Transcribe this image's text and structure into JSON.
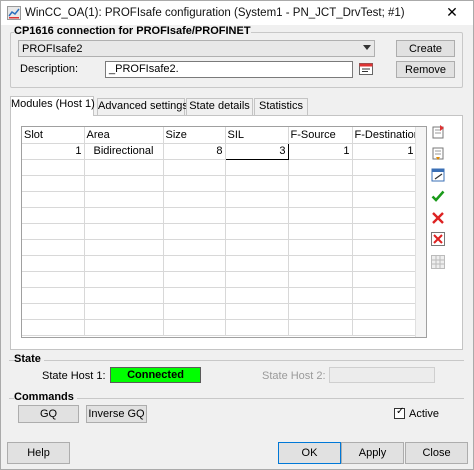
{
  "window": {
    "title": "WinCC_OA(1): PROFIsafe configuration (System1 - PN_JCT_DrvTest; #1)",
    "close_glyph": "✕"
  },
  "connection_group": {
    "title": "CP1616 connection for PROFIsafe/PROFINET",
    "selected_value": "PROFIsafe2",
    "create_label": "Create",
    "remove_label": "Remove",
    "description_label": "Description:",
    "description_value": "_PROFIsafe2."
  },
  "tabs": [
    {
      "label": "Modules (Host 1)",
      "active": true
    },
    {
      "label": "Advanced settings",
      "active": false
    },
    {
      "label": "State details",
      "active": false
    },
    {
      "label": "Statistics",
      "active": false
    }
  ],
  "modules_table": {
    "columns": [
      "Slot",
      "Area",
      "Size",
      "SIL",
      "F-Source",
      "F-Destination"
    ],
    "rows": [
      [
        "1",
        "Bidirectional",
        "8",
        "3",
        "1",
        "1"
      ]
    ]
  },
  "side_toolbar": [
    {
      "icon": "insert-row-icon"
    },
    {
      "icon": "append-row-icon"
    },
    {
      "icon": "edit-icon"
    },
    {
      "icon": "checkmark-icon"
    },
    {
      "icon": "delete-icon"
    },
    {
      "icon": "delete-all-icon"
    },
    {
      "icon": "grid-disabled-icon"
    }
  ],
  "state_group": {
    "title": "State",
    "host1_label": "State Host 1:",
    "host1_value": "Connected",
    "host1_color": "#00ff00",
    "host2_label": "State Host 2:",
    "host2_value": ""
  },
  "commands_group": {
    "title": "Commands",
    "gq_label": "GQ",
    "inverse_gq_label": "Inverse GQ",
    "active_label": "Active",
    "active_checked": true
  },
  "footer": {
    "help_label": "Help",
    "ok_label": "OK",
    "apply_label": "Apply",
    "close_label": "Close"
  }
}
